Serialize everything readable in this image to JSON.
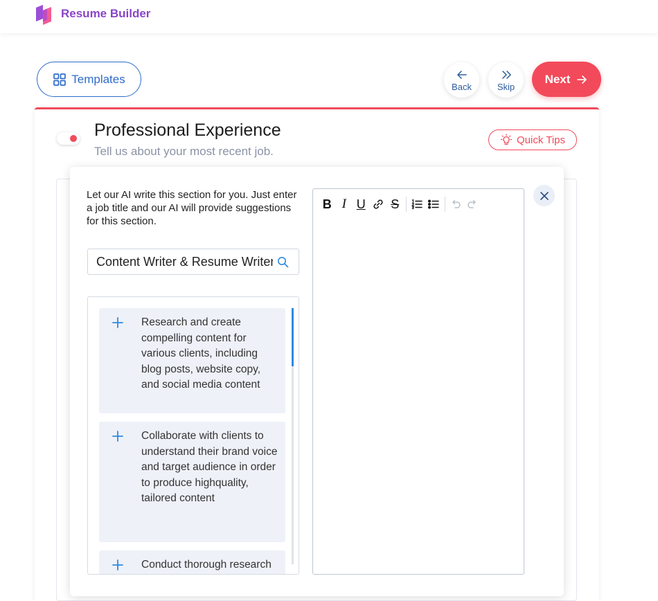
{
  "header": {
    "brand": "Resume Builder",
    "logo_colors": [
      "#9b4fd8",
      "#f24a8a"
    ]
  },
  "nav": {
    "templates_label": "Templates",
    "back_label": "Back",
    "skip_label": "Skip",
    "next_label": "Next"
  },
  "section": {
    "title": "Professional Experience",
    "subtitle": "Tell us about your most recent job.",
    "quick_tips_label": "Quick Tips",
    "toggle_on": true
  },
  "ai_panel": {
    "intro": "Let our AI write this section for you. Just enter a job title and our AI will provide suggestions for this section.",
    "search_value": "Content Writer & Resume Writer",
    "suggestions": [
      "Research and create compelling content for various clients, including blog posts, website copy, and social media content",
      "Collaborate with clients to understand their brand voice and target audience in order to produce highquality, tailored content",
      "Conduct thorough research"
    ]
  },
  "editor": {
    "toolbar": [
      "bold-icon",
      "italic-icon",
      "underline-icon",
      "link-icon",
      "strikethrough-icon",
      "ordered-list-icon",
      "bullet-list-icon",
      "undo-icon",
      "redo-icon"
    ],
    "content": ""
  },
  "colors": {
    "accent": "#f24a5a",
    "primary": "#2d6bc9",
    "brand": "#8a44c9",
    "suggestion_bg": "#eef1f8"
  }
}
